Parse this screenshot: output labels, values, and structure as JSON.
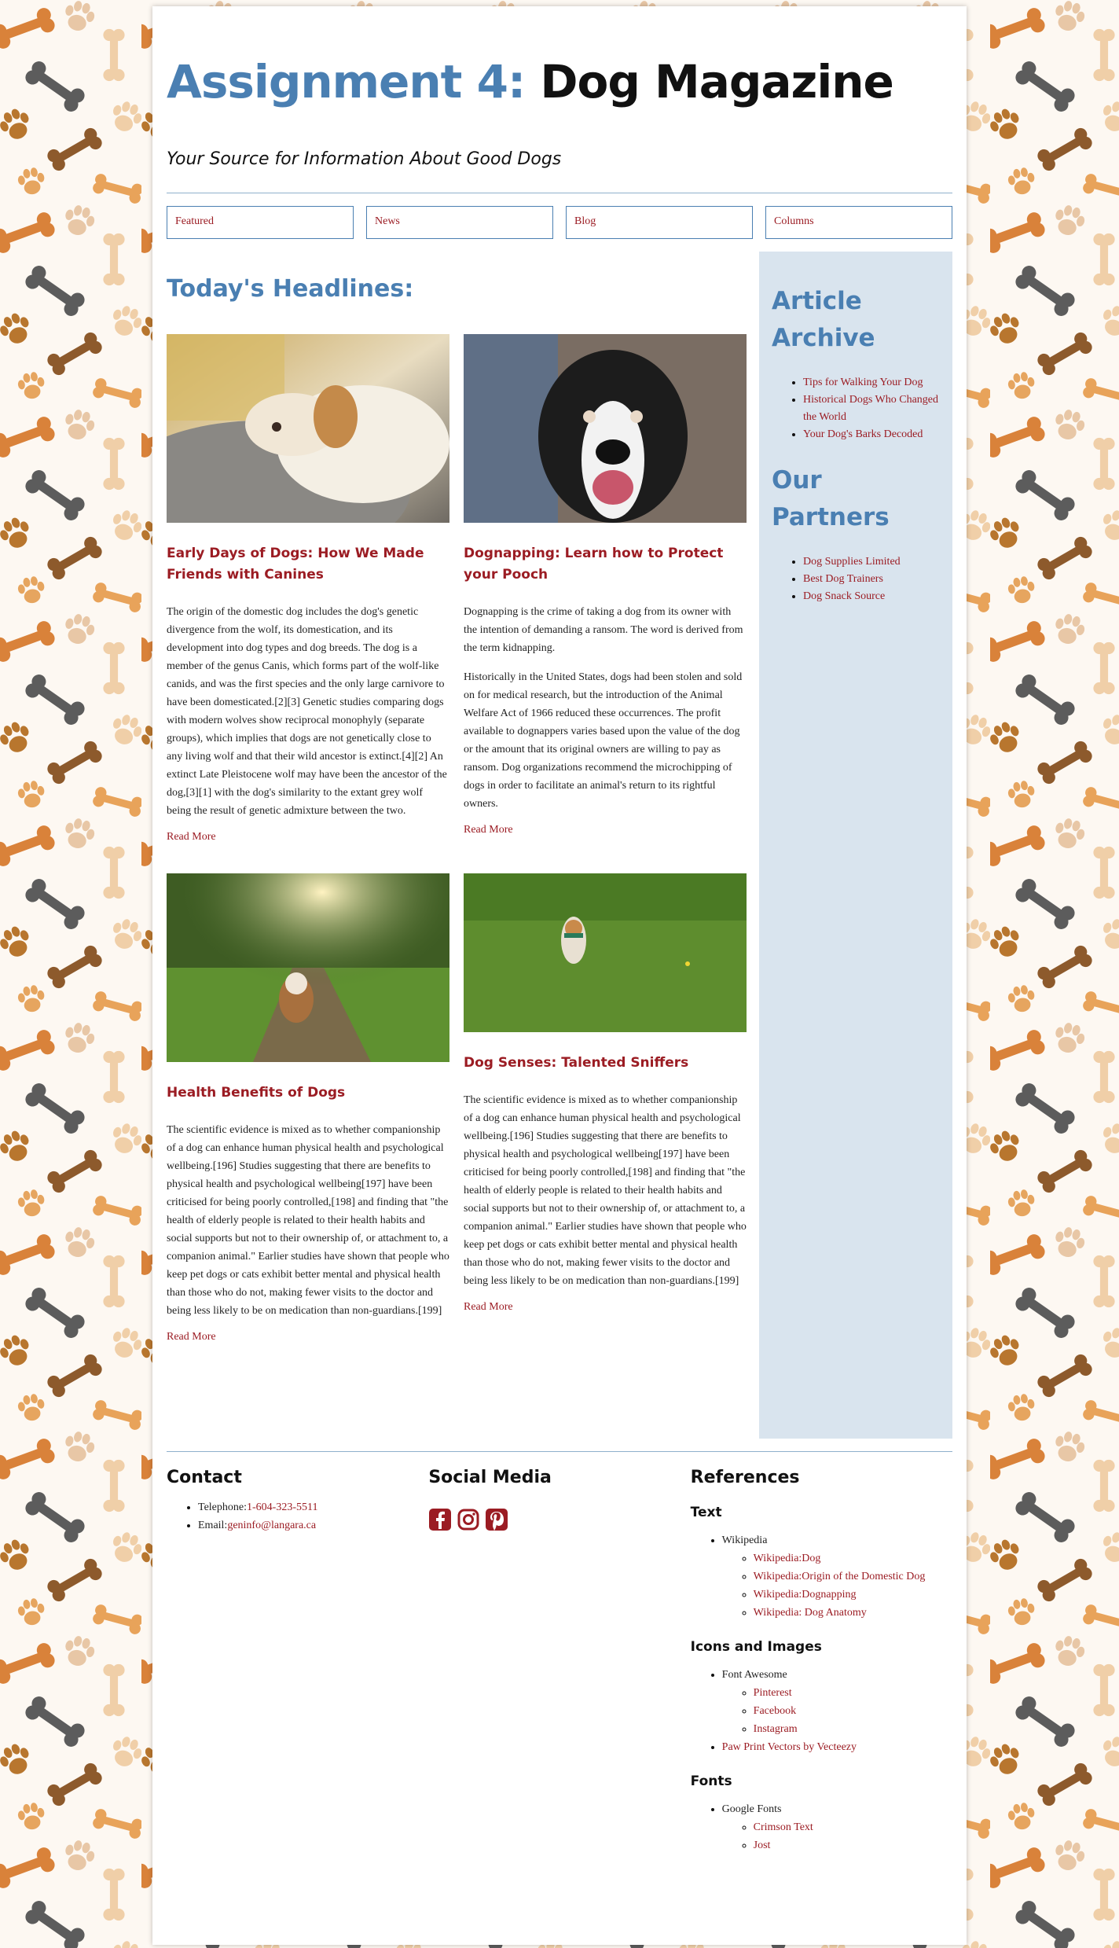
{
  "site": {
    "title_part1": "Assignment 4:",
    "title_part2": " Dog Magazine",
    "tagline": "Your Source for Information About Good Dogs"
  },
  "nav": [
    {
      "label": "Featured"
    },
    {
      "label": "News"
    },
    {
      "label": "Blog"
    },
    {
      "label": "Columns"
    }
  ],
  "main": {
    "heading": "Today's Headlines:",
    "articles": [
      {
        "title": "Early Days of Dogs: How We Made Friends with Canines",
        "paragraphs": [
          "The origin of the domestic dog includes the dog's genetic divergence from the wolf, its domestication, and its development into dog types and dog breeds. The dog is a member of the genus Canis, which forms part of the wolf-like canids, and was the first species and the only large carnivore to have been domesticated.[2][3] Genetic studies comparing dogs with modern wolves show reciprocal monophyly (separate groups), which implies that dogs are not genetically close to any living wolf and that their wild ancestor is extinct.[4][2] An extinct Late Pleistocene wolf may have been the ancestor of the dog,[3][1] with the dog's similarity to the extant grey wolf being the result of genetic admixture between the two."
        ],
        "read_more": "Read More"
      },
      {
        "title": "Dognapping: Learn how to Protect your Pooch",
        "paragraphs": [
          "Dognapping is the crime of taking a dog from its owner with the intention of demanding a ransom. The word is derived from the term kidnapping.",
          "Historically in the United States, dogs had been stolen and sold on for medical research, but the introduction of the Animal Welfare Act of 1966 reduced these occurrences. The profit available to dognappers varies based upon the value of the dog or the amount that its original owners are willing to pay as ransom. Dog organizations recommend the microchipping of dogs in order to facilitate an animal's return to its rightful owners."
        ],
        "read_more": "Read More"
      },
      {
        "title": "Health Benefits of Dogs",
        "paragraphs": [
          "The scientific evidence is mixed as to whether companionship of a dog can enhance human physical health and psychological wellbeing.[196] Studies suggesting that there are benefits to physical health and psychological wellbeing[197] have been criticised for being poorly controlled,[198] and finding that \"the health of elderly people is related to their health habits and social supports but not to their ownership of, or attachment to, a companion animal.\" Earlier studies have shown that people who keep pet dogs or cats exhibit better mental and physical health than those who do not, making fewer visits to the doctor and being less likely to be on medication than non-guardians.[199]"
        ],
        "read_more": "Read More"
      },
      {
        "title": "Dog Senses: Talented Sniffers",
        "paragraphs": [
          "The scientific evidence is mixed as to whether companionship of a dog can enhance human physical health and psychological wellbeing.[196] Studies suggesting that there are benefits to physical health and psychological wellbeing[197] have been criticised for being poorly controlled,[198] and finding that \"the health of elderly people is related to their health habits and social supports but not to their ownership of, or attachment to, a companion animal.\" Earlier studies have shown that people who keep pet dogs or cats exhibit better mental and physical health than those who do not, making fewer visits to the doctor and being less likely to be on medication than non-guardians.[199]"
        ],
        "read_more": "Read More"
      }
    ]
  },
  "sidebar": {
    "archive_heading": "Article Archive",
    "archive_items": [
      "Tips for Walking Your Dog",
      "Historical Dogs Who Changed the World",
      "Your Dog's Barks Decoded"
    ],
    "partners_heading": "Our Partners",
    "partner_items": [
      "Dog Supplies Limited",
      "Best Dog Trainers",
      "Dog Snack Source"
    ]
  },
  "footer": {
    "contact_heading": "Contact",
    "telephone_label": "Telephone:",
    "telephone": "1-604-323-5511",
    "email_label": "Email:",
    "email": "geninfo@langara.ca",
    "social_heading": "Social Media",
    "social_icons": [
      "facebook-icon",
      "instagram-icon",
      "pinterest-icon"
    ],
    "references_heading": "References",
    "text_heading": "Text",
    "text_group": "Wikipedia",
    "text_links": [
      "Wikipedia:Dog",
      "Wikipedia:Origin of the Domestic Dog",
      "Wikipedia:Dognapping",
      "Wikipedia: Dog Anatomy"
    ],
    "icons_heading": "Icons and Images",
    "icons_group": "Font Awesome",
    "icons_links": [
      "Pinterest",
      "Facebook",
      "Instagram"
    ],
    "paw_link": "Paw Print Vectors by Vecteezy",
    "fonts_heading": "Fonts",
    "fonts_group": "Google Fonts",
    "fonts_links": [
      "Crimson Text",
      "Jost"
    ]
  },
  "colors": {
    "accent_blue": "#4a7fb2",
    "link_red": "#9b1c23",
    "sidebar_bg": "#d9e4ee"
  }
}
